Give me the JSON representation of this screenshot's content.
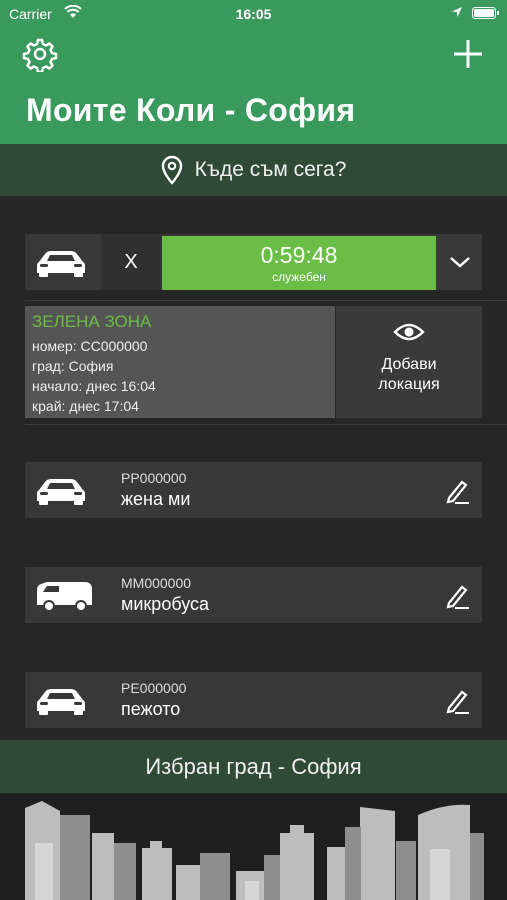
{
  "status_bar": {
    "carrier": "Carrier",
    "time": "16:05"
  },
  "header": {
    "title": "Моите Коли - София"
  },
  "where_bar": {
    "label": "Къде съм сега?"
  },
  "active_parking": {
    "close_label": "X",
    "timer": "0:59:48",
    "timer_label": "служебен",
    "zone": {
      "title": "ЗЕЛЕНА ЗОНА",
      "number": "номер: СС000000",
      "city": "град: София",
      "start": "начало: днес 16:04",
      "end": "край: днес 17:04"
    },
    "add_location": {
      "line1": "Добави",
      "line2": "локация"
    }
  },
  "cars": [
    {
      "plate": "РР000000",
      "name": "жена ми",
      "icon": "car-icon"
    },
    {
      "plate": "ММ000000",
      "name": "микробуса",
      "icon": "van-icon"
    },
    {
      "plate": "РЕ000000",
      "name": "пежото",
      "icon": "car-icon"
    }
  ],
  "city_bar": {
    "label": "Избран град - София"
  },
  "colors": {
    "header": "#3a9a5e",
    "dark_green": "#2f4a35",
    "timer_green": "#6abd45",
    "background": "#262626"
  }
}
